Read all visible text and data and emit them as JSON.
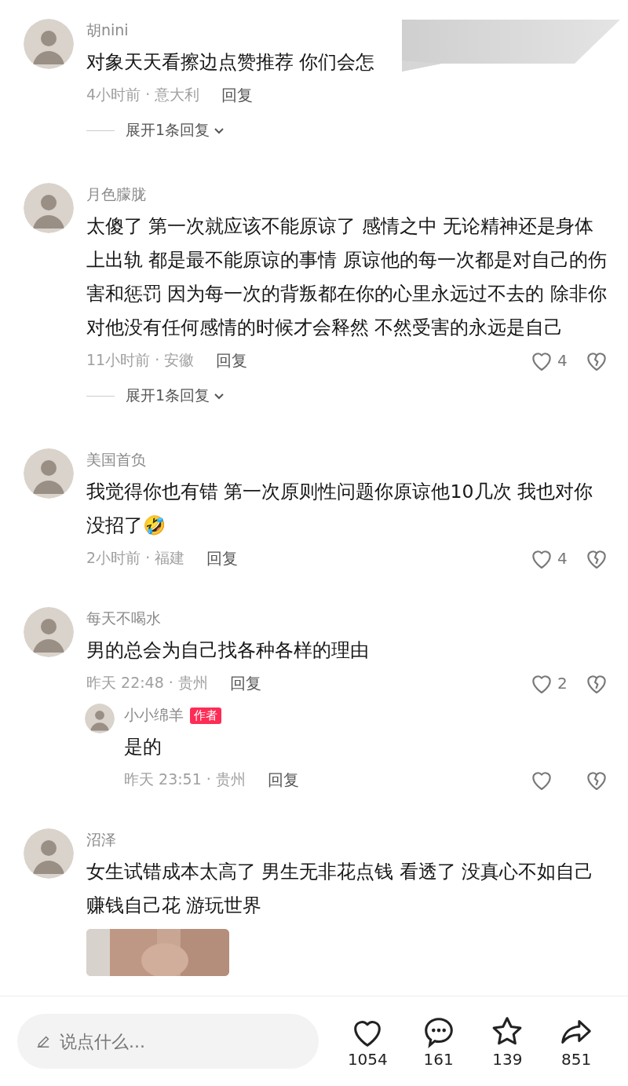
{
  "comments": [
    {
      "user": "胡nini",
      "text": "对象天天看擦边点赞推荐 你们会怎",
      "meta": "4小时前 · 意大利",
      "reply_label": "回复",
      "reactions": false,
      "expand": "展开1条回复"
    },
    {
      "user": "月色朦胧",
      "text": "太傻了 第一次就应该不能原谅了 感情之中 无论精神还是身体上出轨 都是最不能原谅的事情 原谅他的每一次都是对自己的伤害和惩罚 因为每一次的背叛都在你的心里永远过不去的 除非你对他没有任何感情的时候才会释然 不然受害的永远是自己",
      "meta": "11小时前 · 安徽",
      "reply_label": "回复",
      "reactions": true,
      "likes": "4",
      "expand": "展开1条回复"
    },
    {
      "user": "美国首负",
      "text": "我觉得你也有错 第一次原则性问题你原谅他10几次 我也对你没招了🤣",
      "meta": "2小时前 · 福建",
      "reply_label": "回复",
      "reactions": true,
      "likes": "4"
    },
    {
      "user": "每天不喝水",
      "text": "男的总会为自己找各种各样的理由",
      "meta": "昨天 22:48 · 贵州",
      "reply_label": "回复",
      "reactions": true,
      "likes": "2",
      "replies": [
        {
          "user": "小小绵羊",
          "badge": "作者",
          "text": "是的",
          "meta": "昨天 23:51 · 贵州",
          "reply_label": "回复",
          "reactions": true
        }
      ]
    },
    {
      "user": "沼泽",
      "text": "女生试错成本太高了 男生无非花点钱 看透了 没真心不如自己赚钱自己花 游玩世界"
    }
  ],
  "bottom_bar": {
    "placeholder": "说点什么...",
    "actions": [
      {
        "kind": "like",
        "count": "1054"
      },
      {
        "kind": "comment",
        "count": "161"
      },
      {
        "kind": "favorite",
        "count": "139"
      },
      {
        "kind": "share",
        "count": "851"
      }
    ]
  }
}
